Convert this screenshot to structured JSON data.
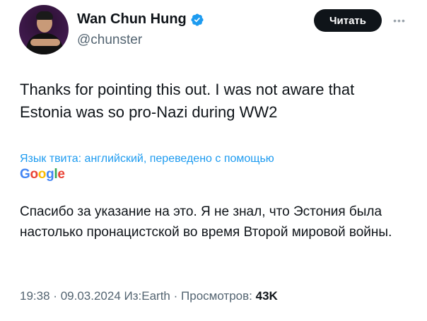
{
  "author": {
    "name": "Wan Chun Hung",
    "handle": "@chunster",
    "verified": true,
    "verified_color": "#1d9bf0"
  },
  "follow_button": {
    "label": "Читать"
  },
  "more_menu": {
    "icon": "more-dots-icon"
  },
  "tweet": {
    "text": "Thanks for pointing this out. I was not aware that Estonia was so pro-Nazi during WW2"
  },
  "translation": {
    "note": "Язык твита: английский, переведено с помощью",
    "provider": "Google",
    "text": "Спасибо за указание на это. Я не знал, что Эстония была настолько пронацистской во время Второй мировой войны."
  },
  "meta": {
    "time": "19:38",
    "separator": "·",
    "date": "09.03.2024",
    "source": "Из:Earth",
    "views_label": "Просмотров:",
    "views_count": "43K"
  },
  "colors": {
    "accent": "#1d9bf0",
    "text": "#0f1419",
    "secondary": "#536471",
    "google_blue": "#4285f4",
    "google_red": "#ea4335",
    "google_yellow": "#fbbc05",
    "google_green": "#34a853"
  }
}
